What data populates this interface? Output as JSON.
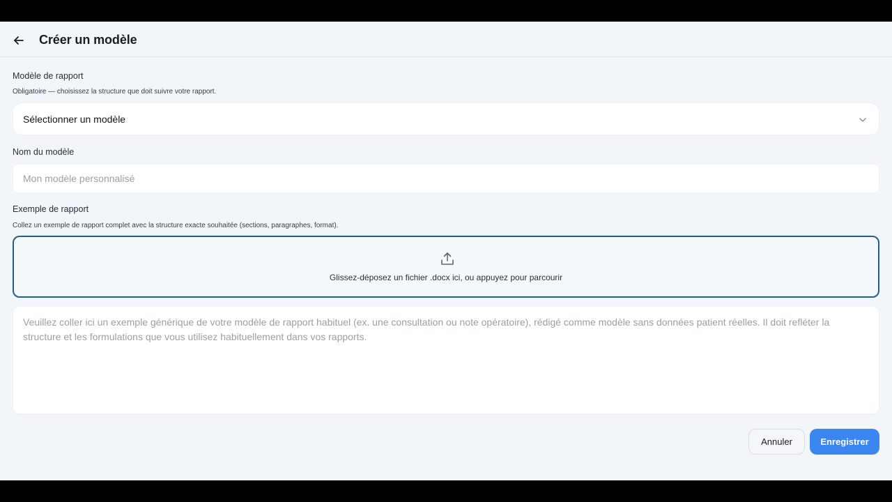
{
  "header": {
    "title": "Créer un modèle",
    "back_icon": "arrow-left-icon"
  },
  "template_field": {
    "label": "Modèle de rapport",
    "hint": "Obligatoire — choisissez la structure que doit suivre votre rapport.",
    "selected_value": "Sélectionner un modèle",
    "icon": "chevron-down-icon"
  },
  "name_field": {
    "label": "Nom du modèle",
    "value": "",
    "placeholder": "Mon modèle personnalisé"
  },
  "example_field": {
    "label": "Exemple de rapport",
    "hint": "Collez un exemple de rapport complet avec la structure exacte souhaitée (sections, paragraphes, format).",
    "dropzone_text": "Glissez-déposez un fichier .docx ici, ou appuyez pour parcourir",
    "dropzone_icon": "upload-icon",
    "textarea_value": "",
    "textarea_placeholder": "Veuillez coller ici un exemple générique de votre modèle de rapport habituel (ex. une consultation ou note opératoire), rédigé comme modèle sans données patient réelles. Il doit refléter la structure et les formulations que vous utilisez habituellement dans vos rapports."
  },
  "actions": {
    "cancel_label": "Annuler",
    "save_label": "Enregistrer"
  },
  "colors": {
    "background": "#f2f5f9",
    "primary": "#3b86f0",
    "dropzone_border": "#1f5f8b"
  }
}
